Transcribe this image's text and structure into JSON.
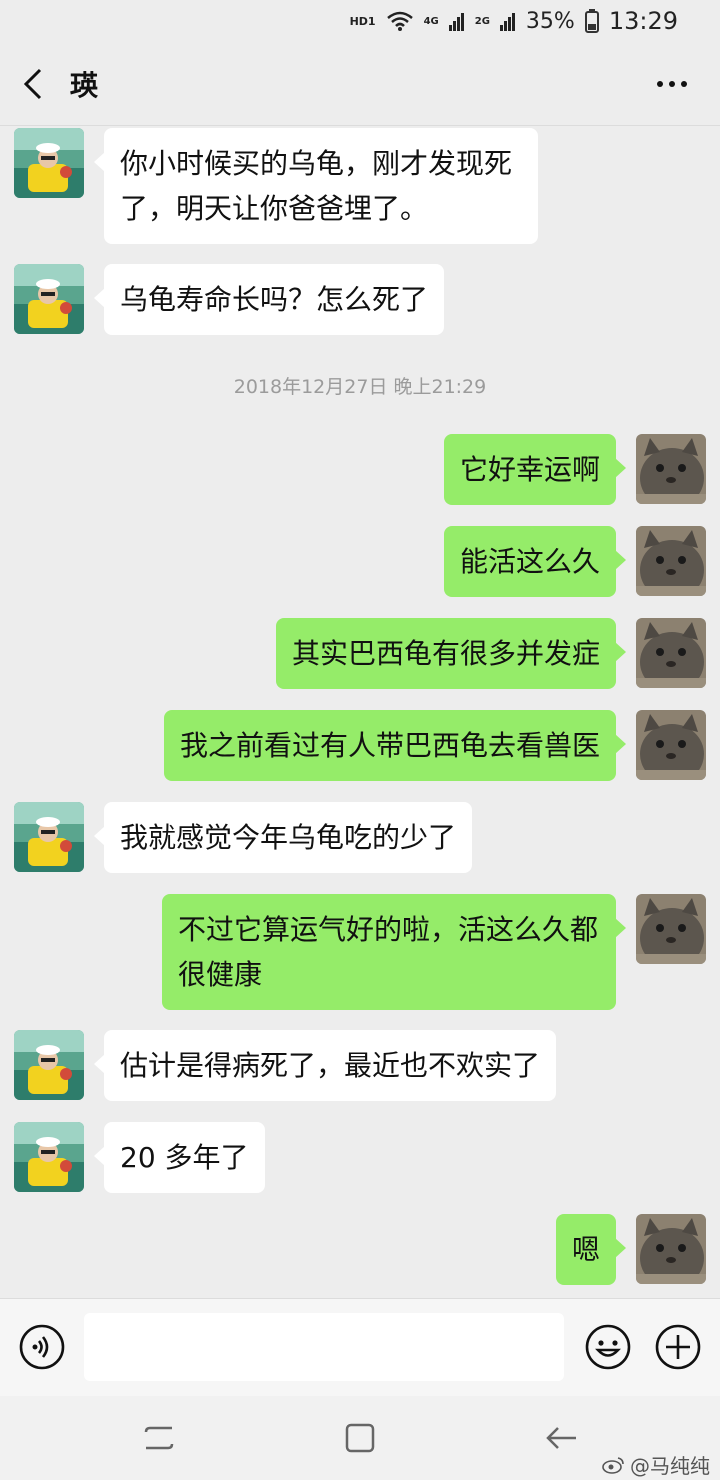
{
  "status": {
    "network_labels": [
      "HD1",
      "4G",
      "2G"
    ],
    "battery": "35%",
    "time": "13:29"
  },
  "header": {
    "title": "瑛"
  },
  "timestamp": "2018年12月27日 晚上21:29",
  "messages": [
    {
      "side": "left",
      "text": "你小时候买的乌龟，刚才发现死了，明天让你爸爸埋了。"
    },
    {
      "side": "left",
      "text": "乌龟寿命长吗？怎么死了"
    },
    {
      "side": "right",
      "text": "它好幸运啊"
    },
    {
      "side": "right",
      "text": "能活这么久"
    },
    {
      "side": "right",
      "text": "其实巴西龟有很多并发症"
    },
    {
      "side": "right",
      "text": "我之前看过有人带巴西龟去看兽医"
    },
    {
      "side": "left",
      "text": "我就感觉今年乌龟吃的少了"
    },
    {
      "side": "right",
      "text": "不过它算运气好的啦，活这么久都很健康"
    },
    {
      "side": "left",
      "text": "估计是得病死了，最近也不欢实了"
    },
    {
      "side": "left",
      "text": "20 多年了"
    },
    {
      "side": "right",
      "text": "嗯"
    }
  ],
  "input": {
    "value": "",
    "placeholder": ""
  },
  "icons": {
    "back": "chevron-left-icon",
    "more": "more-horizontal-icon",
    "voice": "voice-icon",
    "emoji": "emoji-icon",
    "plus": "plus-icon"
  },
  "watermark": "@马纯纯",
  "colors": {
    "sent_bubble": "#95ec69",
    "received_bubble": "#ffffff",
    "background": "#ededed"
  }
}
